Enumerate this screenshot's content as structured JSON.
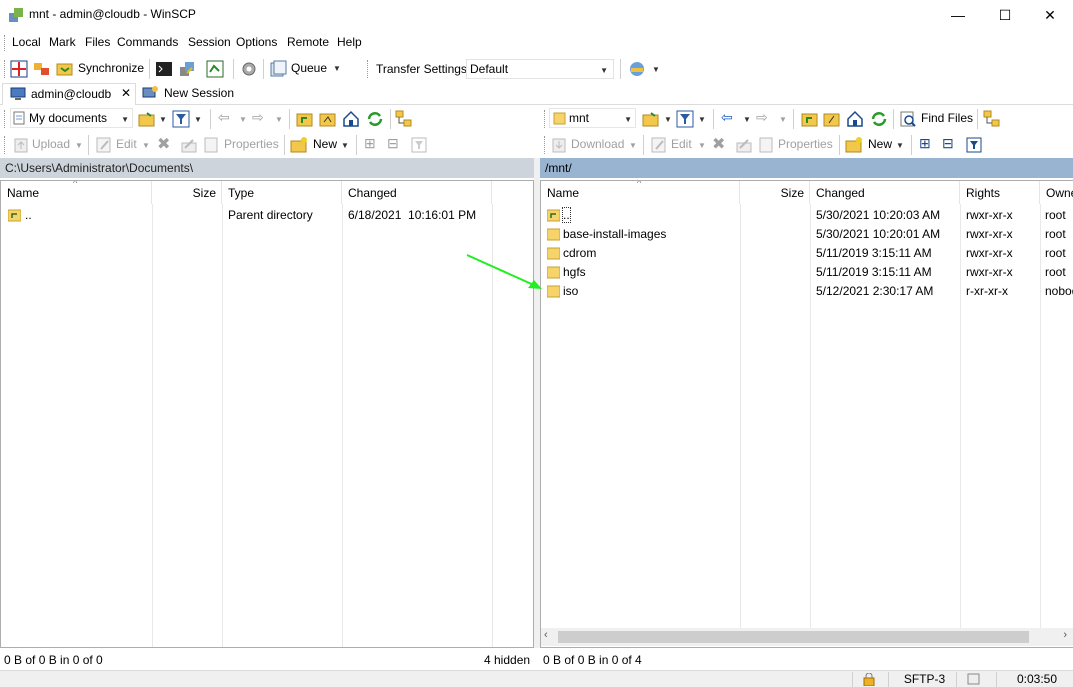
{
  "window": {
    "title": "mnt - admin@cloudb - WinSCP",
    "minimize": "—",
    "maximize": "☐",
    "close": "✕"
  },
  "menu": [
    "Local",
    "Mark",
    "Files",
    "Commands",
    "Session",
    "Options",
    "Remote",
    "Help"
  ],
  "toolbar": {
    "synchronize": "Synchronize",
    "queue": "Queue",
    "transfer_settings_label": "Transfer Settings",
    "transfer_settings_value": "Default"
  },
  "tabs": {
    "session": "admin@cloudb",
    "new_session": "New Session"
  },
  "left": {
    "location": "My documents",
    "upload": "Upload",
    "edit": "Edit",
    "properties": "Properties",
    "new": "New",
    "path": "C:\\Users\\Administrator\\Documents\\",
    "columns": [
      "Name",
      "Size",
      "Type",
      "Changed"
    ],
    "rows": [
      {
        "name": "..",
        "size": "",
        "type": "Parent directory",
        "changed": "6/18/2021  10:16:01 PM"
      }
    ],
    "status": "0 B of 0 B in 0 of 0",
    "hidden": "4 hidden"
  },
  "right": {
    "location": "mnt",
    "download": "Download",
    "edit": "Edit",
    "properties": "Properties",
    "new": "New",
    "find_files": "Find Files",
    "path": "/mnt/",
    "columns": [
      "Name",
      "Size",
      "Changed",
      "Rights",
      "Owner"
    ],
    "rows": [
      {
        "name": "..",
        "size": "",
        "changed": "5/30/2021 10:20:03 AM",
        "rights": "rwxr-xr-x",
        "owner": "root"
      },
      {
        "name": "base-install-images",
        "size": "",
        "changed": "5/30/2021 10:20:01 AM",
        "rights": "rwxr-xr-x",
        "owner": "root"
      },
      {
        "name": "cdrom",
        "size": "",
        "changed": "5/11/2019 3:15:11 AM",
        "rights": "rwxr-xr-x",
        "owner": "root"
      },
      {
        "name": "hgfs",
        "size": "",
        "changed": "5/11/2019 3:15:11 AM",
        "rights": "rwxr-xr-x",
        "owner": "root"
      },
      {
        "name": "iso",
        "size": "",
        "changed": "5/12/2021 2:30:17 AM",
        "rights": "r-xr-xr-x",
        "owner": "nobody"
      }
    ],
    "status": "0 B of 0 B in 0 of 4"
  },
  "statusbar": {
    "protocol": "SFTP-3",
    "time": "0:03:50"
  },
  "colors": {
    "folder": "#f7c948",
    "active_path": "#99b4d1",
    "inactive_path": "#cdd4db",
    "annotation_arrow": "#22ee22"
  }
}
